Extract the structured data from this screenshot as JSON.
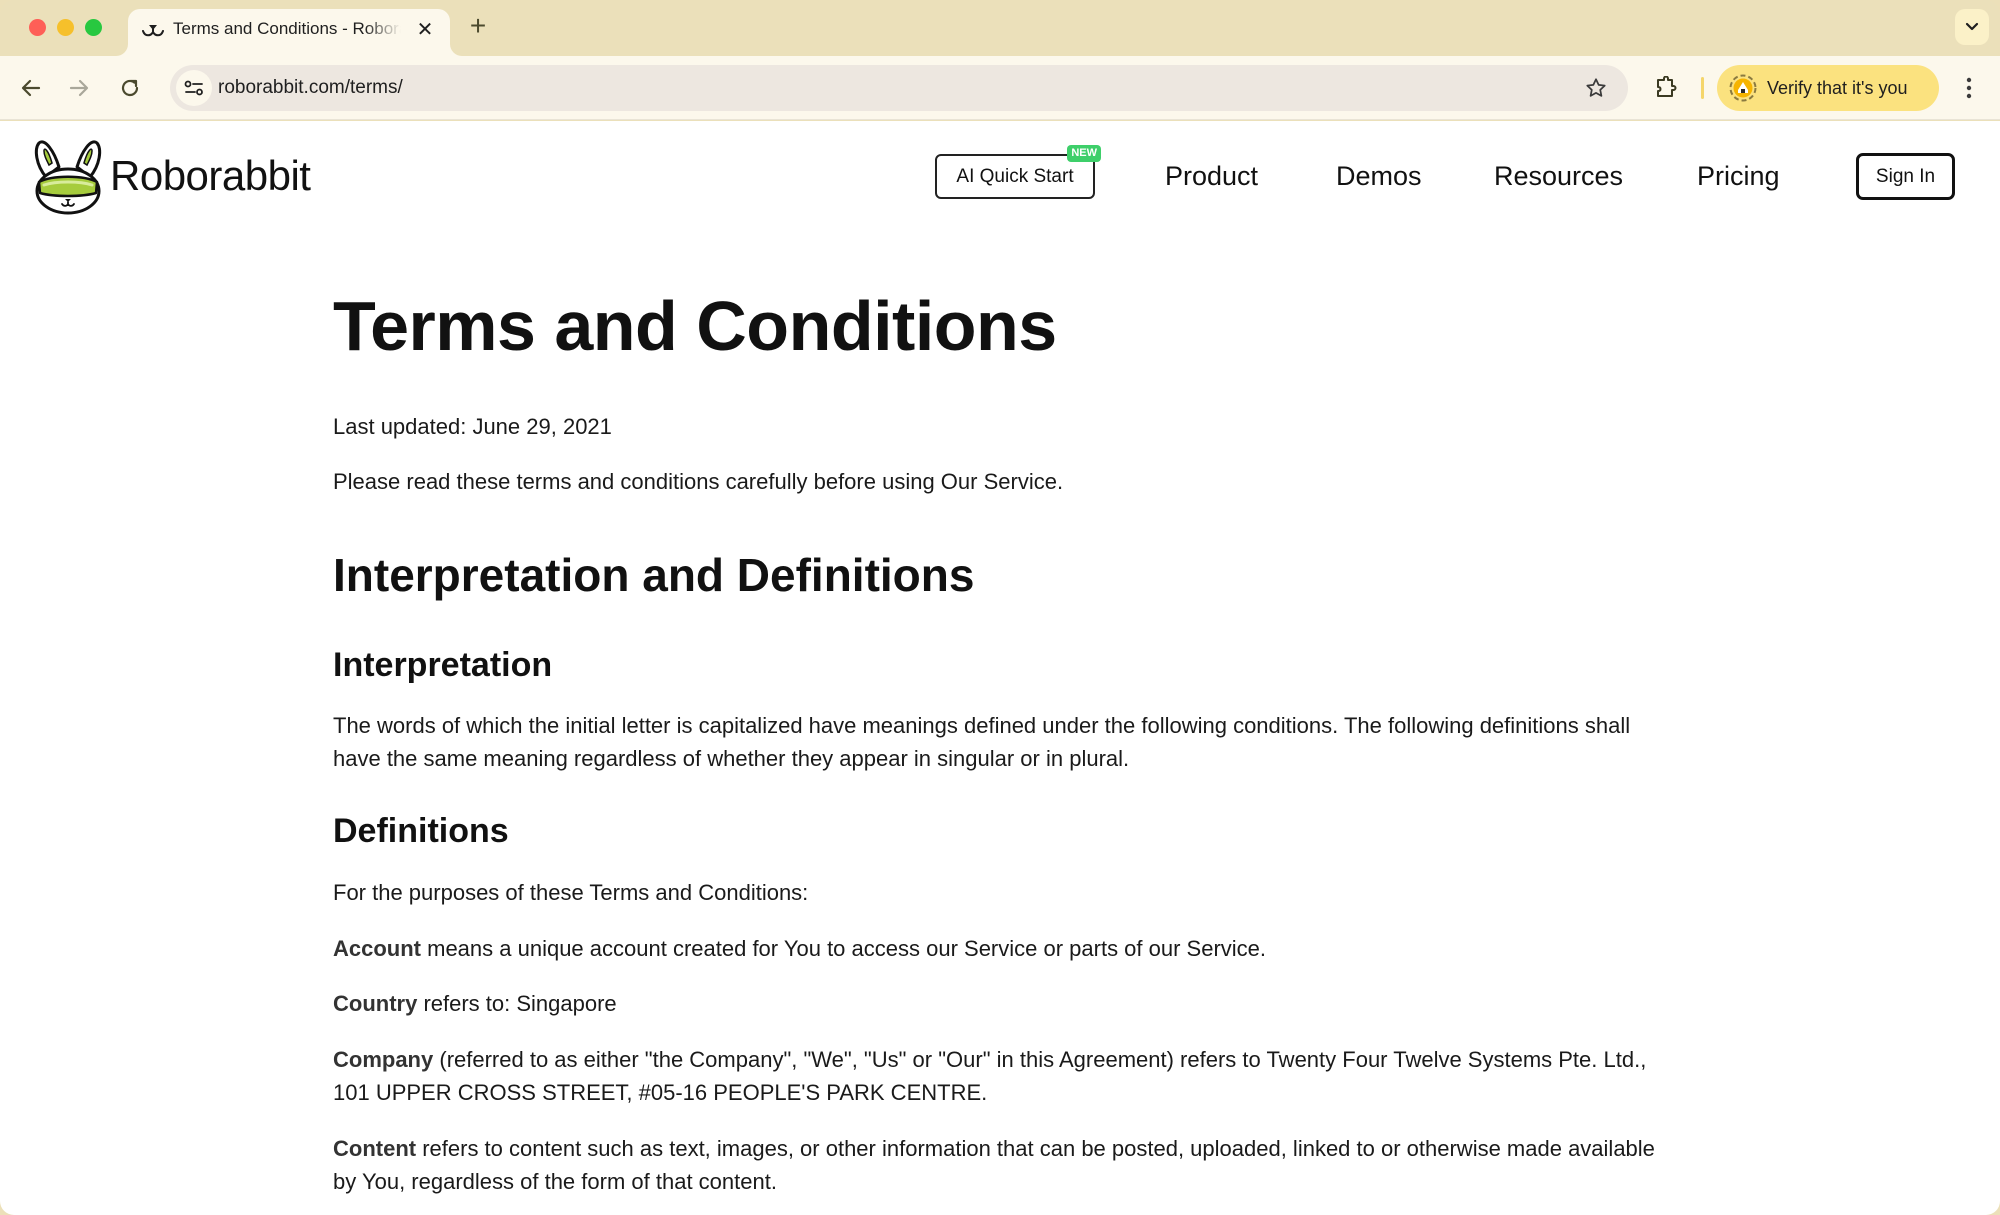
{
  "browser": {
    "tab": {
      "title": "Terms and Conditions - Roborabbit",
      "favicon": "rabbit-nose-icon"
    },
    "url": "roborabbit.com/terms/",
    "verify_label": "Verify that it's you",
    "icons": [
      "back-icon",
      "forward-icon",
      "reload-icon",
      "site-info-icon",
      "bookmark-star-icon",
      "extensions-icon",
      "profile-icon",
      "menu-icon",
      "tab-search-icon",
      "new-tab-icon",
      "close-tab-icon"
    ]
  },
  "site": {
    "logo_text": "Roborabbit",
    "nav": {
      "ai_quick_start": "AI Quick Start",
      "new_badge": "NEW",
      "links": [
        "Product",
        "Demos",
        "Resources",
        "Pricing"
      ],
      "sign_in": "Sign In"
    },
    "accent_color": "#3ecf6a",
    "logo_green": "#a6cc3d"
  },
  "content": {
    "title": "Terms and Conditions",
    "last_updated": "Last updated: June 29, 2021",
    "intro": "Please read these terms and conditions carefully before using Our Service.",
    "section_heading": "Interpretation and Definitions",
    "interpretation": {
      "heading": "Interpretation",
      "body": "The words of which the initial letter is capitalized have meanings defined under the following conditions. The following definitions shall have the same meaning regardless of whether they appear in singular or in plural."
    },
    "definitions": {
      "heading": "Definitions",
      "intro": "For the purposes of these Terms and Conditions:",
      "items": [
        {
          "term": "Account",
          "text": " means a unique account created for You to access our Service or parts of our Service."
        },
        {
          "term": "Country",
          "text": " refers to: Singapore"
        },
        {
          "term": "Company",
          "text": " (referred to as either \"the Company\", \"We\", \"Us\" or \"Our\" in this Agreement) refers to Twenty Four Twelve Systems Pte. Ltd., 101 UPPER CROSS STREET, #05-16 PEOPLE'S PARK CENTRE."
        },
        {
          "term": "Content",
          "text": " refers to content such as text, images, or other information that can be posted, uploaded, linked to or otherwise made available by You, regardless of the form of that content."
        }
      ]
    }
  }
}
